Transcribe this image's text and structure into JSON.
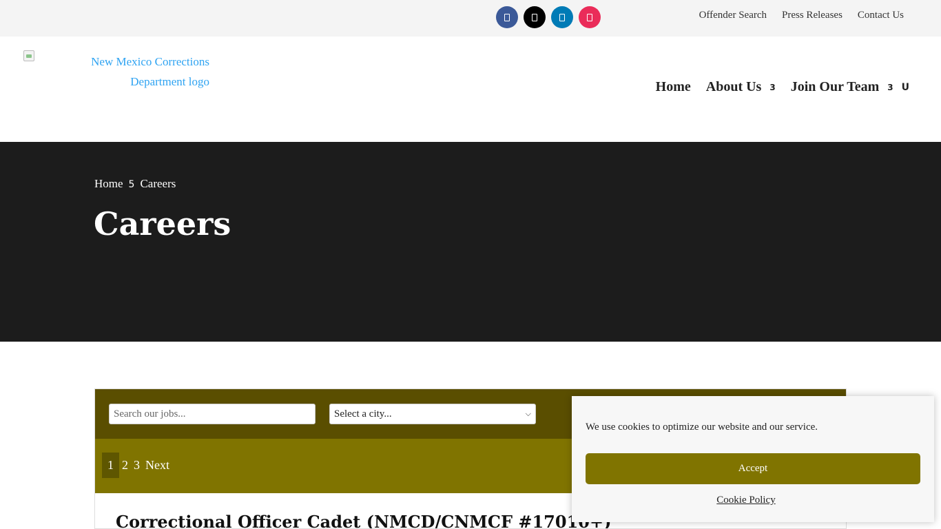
{
  "topbar": {
    "social": [
      {
        "name": "facebook-icon",
        "color": "#3b5998"
      },
      {
        "name": "x-icon",
        "color": "#000000"
      },
      {
        "name": "linkedin-icon",
        "color": "#007bb6"
      },
      {
        "name": "instagram-icon",
        "color": "#ea2c59"
      }
    ],
    "links": [
      "Offender Search",
      "Press Releases",
      "Contact Us"
    ]
  },
  "header": {
    "logo_alt_line1": "New Mexico Corrections",
    "logo_alt_line2": "Department logo",
    "nav": [
      {
        "label": "Home"
      },
      {
        "label": "About Us",
        "caret": "3"
      },
      {
        "label": "Join Our Team",
        "caret": "3"
      }
    ],
    "search_glyph": "U"
  },
  "hero": {
    "breadcrumb": [
      "Home",
      "5",
      "Careers"
    ],
    "title": "Careers"
  },
  "board": {
    "search_placeholder": "Search our jobs...",
    "city_select": "Select a city...",
    "pages": [
      "1",
      "2",
      "3"
    ],
    "next_label": "Next",
    "first_job_title": "Correctional Officer Cadet (NMCD/CNMCF #17010+)"
  },
  "cookie": {
    "message": "We use cookies to optimize our website and our service.",
    "accept_label": "Accept",
    "policy_label": "Cookie Policy"
  },
  "colors": {
    "olive_dark": "#5a4e00",
    "olive": "#807400",
    "hero_bg": "#1c1c1c",
    "link_blue": "#2ea3f2"
  }
}
